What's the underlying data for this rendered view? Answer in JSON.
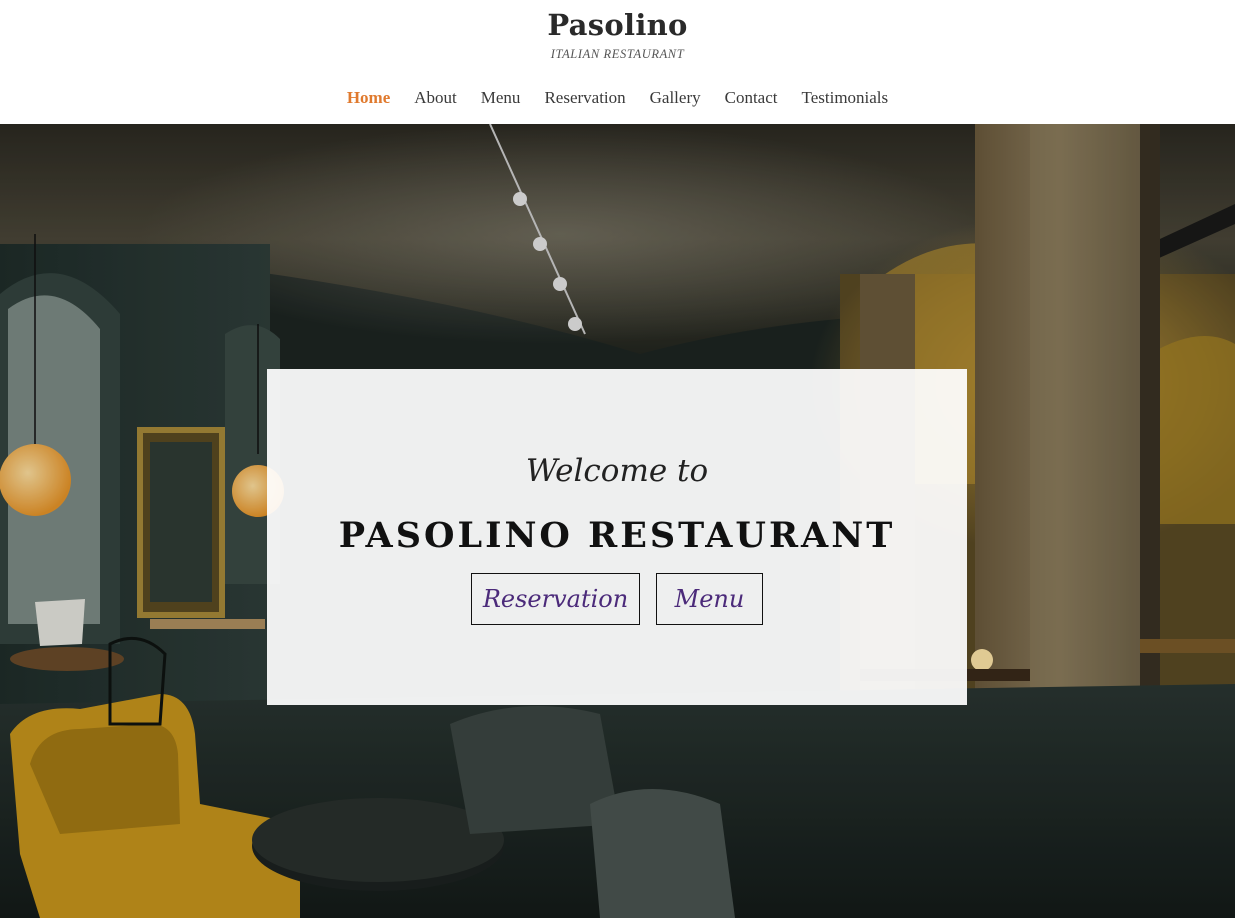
{
  "brand": {
    "name": "Pasolino",
    "tagline": "ITALIAN RESTAURANT"
  },
  "nav": {
    "items": [
      {
        "label": "Home",
        "active": true
      },
      {
        "label": "About",
        "active": false
      },
      {
        "label": "Menu",
        "active": false
      },
      {
        "label": "Reservation",
        "active": false
      },
      {
        "label": "Gallery",
        "active": false
      },
      {
        "label": "Contact",
        "active": false
      },
      {
        "label": "Testimonials",
        "active": false
      }
    ]
  },
  "hero": {
    "welcome": "Welcome to",
    "title": "PASOLINO RESTAURANT",
    "buttons": {
      "reservation": "Reservation",
      "menu": "Menu"
    }
  },
  "colors": {
    "accent": "#e07a2e",
    "button_text": "#4b2a7a",
    "heading": "#2a2a2a"
  }
}
